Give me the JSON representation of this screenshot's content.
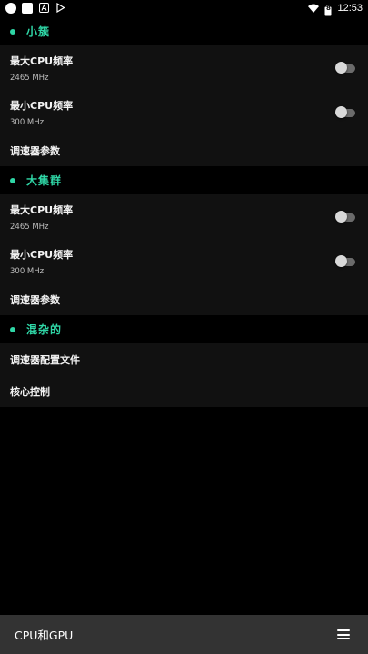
{
  "status_bar": {
    "time": "12:53",
    "battery": "8",
    "left_icons": [
      "circle-icon",
      "square-icon",
      "a-notification-icon",
      "play-store-icon"
    ],
    "right_icons": [
      "wifi-icon",
      "battery-icon"
    ]
  },
  "colors": {
    "accent": "#2fd6a6",
    "card": "#111111",
    "background": "#000000",
    "bottom_bar": "#333333"
  },
  "sections": {
    "little": {
      "title": "小簇",
      "max_freq": {
        "label": "最大CPU频率",
        "value": "2465 MHz",
        "enabled": false
      },
      "min_freq": {
        "label": "最小CPU频率",
        "value": "300 MHz",
        "enabled": false
      },
      "governor": {
        "label": "调速器参数"
      }
    },
    "big": {
      "title": "大集群",
      "max_freq": {
        "label": "最大CPU频率",
        "value": "2465 MHz",
        "enabled": false
      },
      "min_freq": {
        "label": "最小CPU频率",
        "value": "300 MHz",
        "enabled": false
      },
      "governor": {
        "label": "调速器参数"
      }
    },
    "misc": {
      "title": "混杂的",
      "profile": {
        "label": "调速器配置文件"
      },
      "core_control": {
        "label": "核心控制"
      }
    }
  },
  "bottom_bar": {
    "title": "CPU和GPU",
    "menu_icon": "hamburger-menu-icon"
  }
}
